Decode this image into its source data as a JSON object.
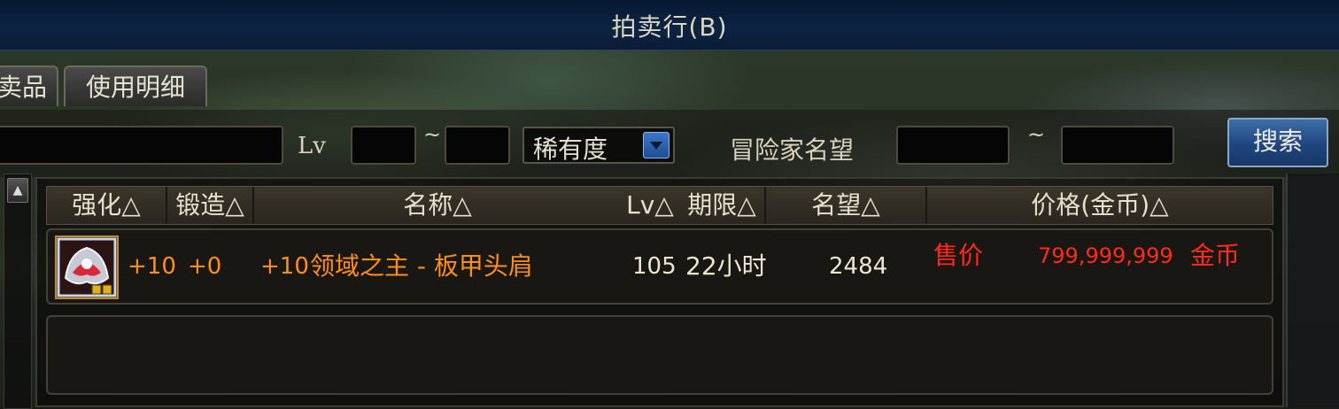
{
  "window": {
    "title": "拍卖行(B)"
  },
  "tabs": [
    {
      "label": "卖品"
    },
    {
      "label": "使用明细"
    }
  ],
  "filters": {
    "lv_label": "Lv",
    "range_sep": "~",
    "rarity_label": "稀有度",
    "fame_label": "冒险家名望",
    "search_label": "搜索"
  },
  "columns": [
    "强化△",
    "锻造△",
    "名称△",
    "Lv△",
    "期限△",
    "名望△",
    "价格(金币)△"
  ],
  "rows": [
    {
      "enhance": "+10",
      "forge": "+0",
      "name_prefix": "+10",
      "name": "领域之主 - 板甲头肩",
      "lv": "105",
      "duration": "22小时",
      "fame": "2484",
      "price_label": "售价",
      "price": "799,999,999",
      "currency": "金币"
    }
  ],
  "scrollbar": {
    "up_glyph": "▲"
  },
  "colors": {
    "item_name": "#ff8e1a",
    "price": "#ff2a1a",
    "title_bar": "#0c2444",
    "search_button": "#1f4680"
  }
}
